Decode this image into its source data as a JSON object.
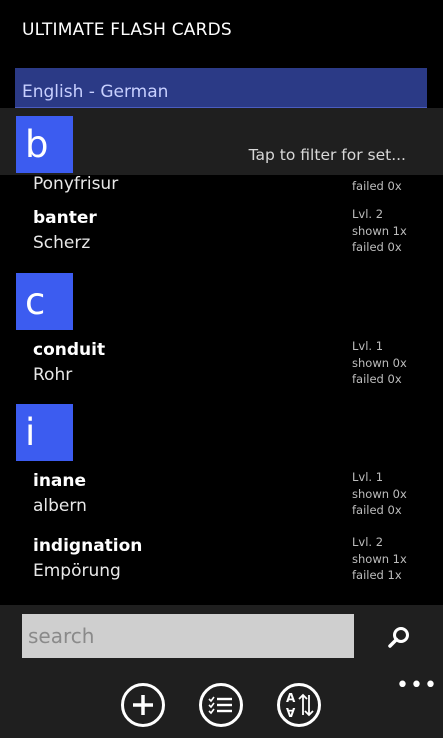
{
  "header": {
    "title": "ULTIMATE FLASH CARDS"
  },
  "language_pair": "English - German",
  "filter": {
    "letter": "b",
    "hint": "Tap to filter for set..."
  },
  "groups": [
    {
      "letter": "b",
      "cards": [
        {
          "term": "",
          "translation": "Ponyfrisur",
          "level": "",
          "shown": "",
          "failed": "failed 0x"
        },
        {
          "term": "banter",
          "translation": "Scherz",
          "level": "Lvl. 2",
          "shown": "shown 1x",
          "failed": "failed 0x"
        }
      ]
    },
    {
      "letter": "c",
      "cards": [
        {
          "term": "conduit",
          "translation": "Rohr",
          "level": "Lvl. 1",
          "shown": "shown 0x",
          "failed": "failed 0x"
        }
      ]
    },
    {
      "letter": "i",
      "cards": [
        {
          "term": "inane",
          "translation": "albern",
          "level": "Lvl. 1",
          "shown": "shown 0x",
          "failed": "failed 0x"
        },
        {
          "term": "indignation",
          "translation": "Empörung",
          "level": "Lvl. 2",
          "shown": "shown 1x",
          "failed": "failed 1x"
        }
      ]
    }
  ],
  "search": {
    "placeholder": "search",
    "value": ""
  },
  "appbar": {
    "more": "•••",
    "sort_top": "A",
    "sort_bottom": "A"
  }
}
